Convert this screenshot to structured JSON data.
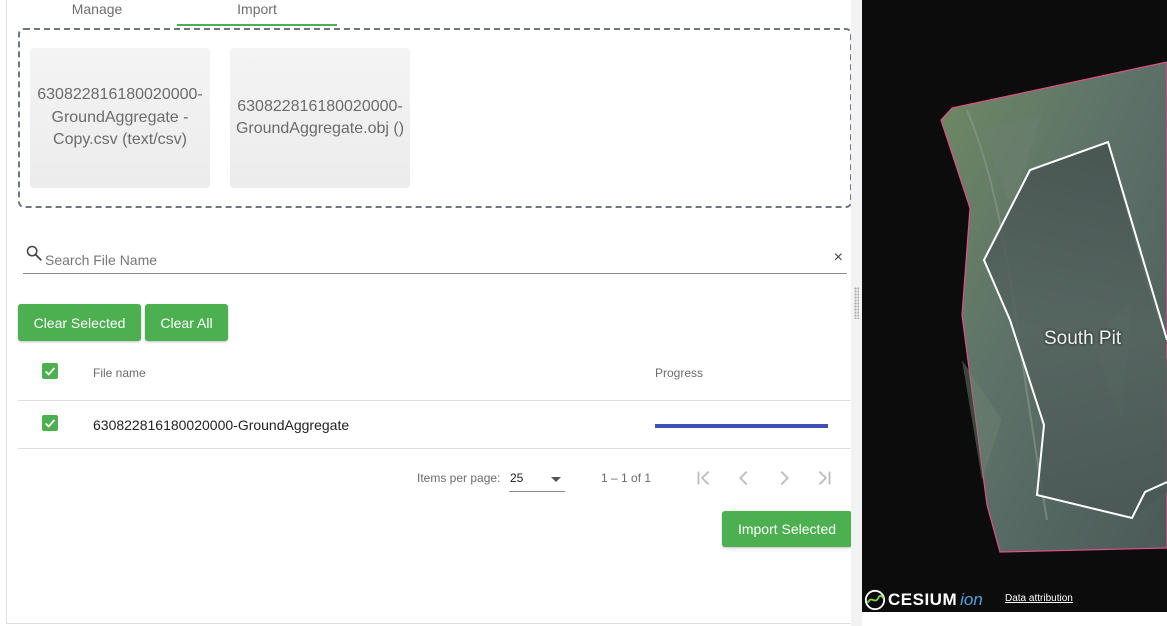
{
  "tabs": [
    {
      "label": "Manage",
      "active": false
    },
    {
      "label": "Import",
      "active": true
    }
  ],
  "dropzone": {
    "files": [
      {
        "label": "630822816180020000-GroundAggregate - Copy.csv (text/csv)"
      },
      {
        "label": "630822816180020000-GroundAggregate.obj ()"
      }
    ]
  },
  "search": {
    "value": "",
    "placeholder": "Search File Name",
    "clear_glyph": "×"
  },
  "actions": {
    "clear_selected": "Clear Selected",
    "clear_all": "Clear All",
    "import_selected": "Import Selected"
  },
  "table": {
    "columns": {
      "name": "File name",
      "progress": "Progress"
    },
    "header_checked": true,
    "rows": [
      {
        "name": "630822816180020000-GroundAggregate",
        "checked": true,
        "progress_percent": 100
      }
    ]
  },
  "paginator": {
    "items_per_page_label": "Items per page:",
    "items_per_page": "25",
    "range": "1 – 1 of 1"
  },
  "map": {
    "label": "South Pit",
    "logo_main": "CESIUM",
    "logo_ion": "ion",
    "attribution": "Data attribution"
  },
  "colors": {
    "accent_green": "#4caf50",
    "progress_blue": "#3f51b5",
    "map_outline": "#ffffff",
    "tile_edge": "#e0508a"
  },
  "icons": [
    "search-icon",
    "close-icon",
    "check-icon",
    "first-page-icon",
    "chevron-left-icon",
    "chevron-right-icon",
    "last-page-icon",
    "chevron-down-icon",
    "cesium-logo-icon",
    "drag-handle-icon"
  ]
}
